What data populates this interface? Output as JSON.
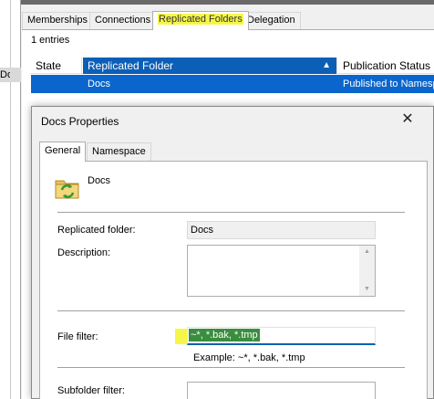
{
  "left_pane": {
    "cut_text": "Docs"
  },
  "tabs": [
    {
      "label": "Memberships",
      "active": false
    },
    {
      "label": "Connections",
      "active": false
    },
    {
      "label": "Replicated Folders",
      "active": true,
      "highlighted": true
    },
    {
      "label": "Delegation",
      "active": false
    }
  ],
  "list": {
    "entries_count": "1 entries",
    "columns": [
      "State",
      "Replicated Folder",
      "Publication Status"
    ],
    "sort_indicator": "▲",
    "rows": [
      {
        "state": "",
        "folder": "Docs",
        "status": "Published to Namespace"
      }
    ]
  },
  "dialog": {
    "title": "Docs Properties",
    "close_glyph": "✕",
    "tabs": [
      "General",
      "Namespace"
    ],
    "active_tab": "General",
    "folder_name": "Docs",
    "folder_icon": "replicated-folder-icon",
    "fields": {
      "replicated_folder_label": "Replicated folder:",
      "replicated_folder_value": "Docs",
      "description_label": "Description:",
      "description_value": "",
      "file_filter_label": "File filter:",
      "file_filter_value": "~*, *.bak, *.tmp",
      "file_filter_example": "Example: ~*, *.bak, *.tmp",
      "subfolder_filter_label": "Subfolder filter:",
      "subfolder_filter_value": ""
    }
  },
  "colors": {
    "selection_blue": "#0a66cc",
    "sorted_header_blue": "#0c5fb7",
    "highlighter_yellow": "#f6f64a",
    "text_selection_green": "#3a8d3f",
    "focus_underline": "#0063b1"
  }
}
